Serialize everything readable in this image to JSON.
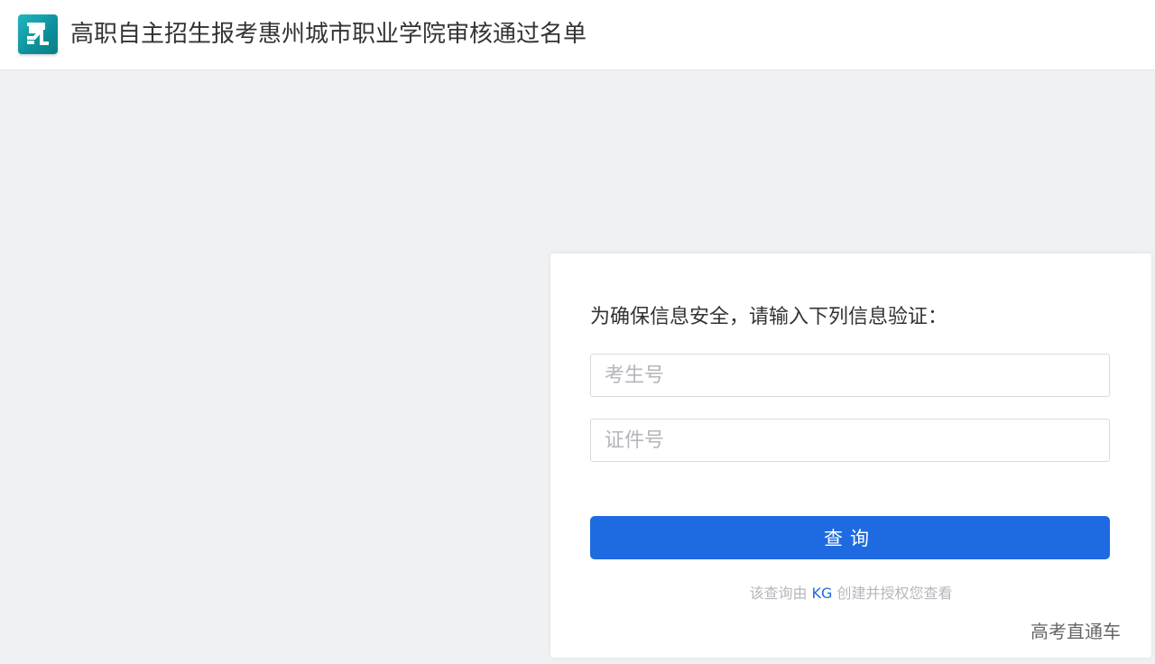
{
  "header": {
    "title": "高职自主招生报考惠州城市职业学院审核通过名单",
    "logo_icon": "app-logo-icon",
    "logo_color": "#14a3ad"
  },
  "form": {
    "prompt": "为确保信息安全，请输入下列信息验证：",
    "candidate_number": {
      "value": "",
      "placeholder": "考生号"
    },
    "id_number": {
      "value": "",
      "placeholder": "证件号"
    },
    "submit_label": "查询",
    "footnote_prefix": "该查询由",
    "footnote_brand": "KG",
    "footnote_suffix": "创建并授权您查看",
    "accent_color": "#1e6ae0"
  },
  "watermark": "高考直通车"
}
